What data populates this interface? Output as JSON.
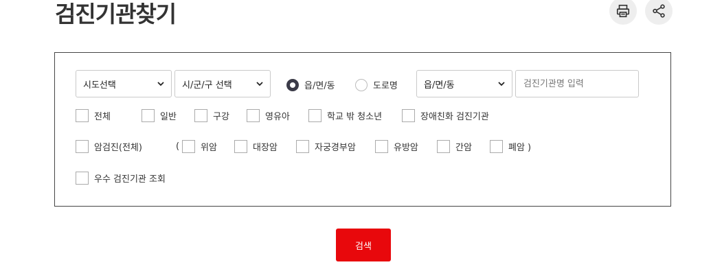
{
  "page": {
    "title": "검진기관찾기"
  },
  "toolbar": {
    "print_icon": "printer-icon",
    "share_icon": "share-icon"
  },
  "filters": {
    "sido": {
      "selected": "시도선택"
    },
    "sigungu": {
      "selected": "시/군/구 선택"
    },
    "address_type": {
      "eupmyeondong_label": "읍/면/동",
      "road_label": "도로명",
      "selected": "읍/면/동"
    },
    "dong": {
      "selected": "읍/면/동"
    },
    "name_input": {
      "placeholder": "검진기관명 입력",
      "value": ""
    }
  },
  "checkboxes": {
    "row1": {
      "all": "전체",
      "general": "일반",
      "oral": "구강",
      "infant": "영유아",
      "out_of_school": "학교 밖 청소년",
      "disability_friendly": "장애친화 검진기관"
    },
    "cancer": {
      "all": "암검진(전체)",
      "open_paren": "(",
      "stomach": "위암",
      "colorectal": "대장암",
      "cervical": "자궁경부암",
      "breast": "유방암",
      "liver": "간암",
      "lung": "폐암 )"
    },
    "excellent": "우수 검진기관 조회"
  },
  "actions": {
    "search_label": "검색"
  },
  "colors": {
    "accent": "#e8080c",
    "radio_selected": "#3b3b48"
  }
}
